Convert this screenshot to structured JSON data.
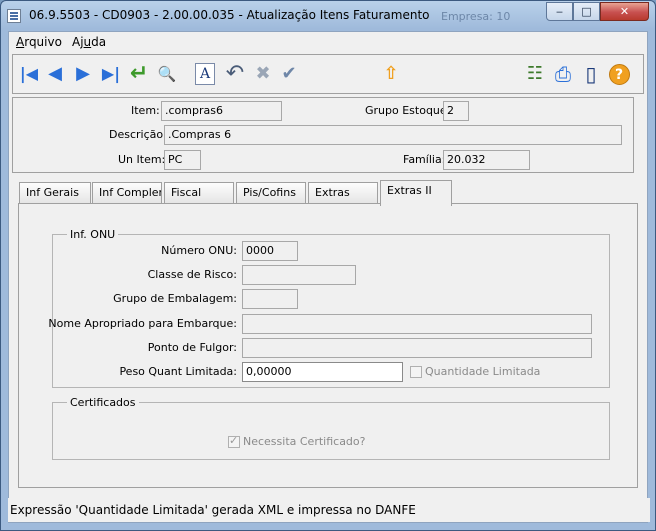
{
  "window": {
    "title": "06.9.5503 - CD0903 - 2.00.00.035 - Atualização Itens Faturamento",
    "background_label": "Empresa: 10",
    "minimize_symbol": "‒",
    "maximize_symbol": "□",
    "close_symbol": "✕"
  },
  "menu": {
    "arquivo": {
      "prefix": "",
      "accel": "A",
      "rest": "rquivo"
    },
    "ajuda": {
      "prefix": "Aj",
      "accel": "u",
      "rest": "da"
    }
  },
  "toolbar": {
    "buttons": [
      {
        "name": "first-record-icon",
        "glyph": "|◀"
      },
      {
        "name": "previous-record-icon",
        "glyph": "◀"
      },
      {
        "name": "next-record-icon",
        "glyph": "▶"
      },
      {
        "name": "last-record-icon",
        "glyph": "▶|"
      },
      {
        "name": "goto-icon",
        "glyph": "↵"
      },
      {
        "name": "search-icon",
        "glyph": "🔍"
      },
      {
        "name": "edit-document-icon",
        "glyph": "A"
      },
      {
        "name": "undo-icon",
        "glyph": "↶"
      },
      {
        "name": "delete-icon",
        "glyph": "✖"
      },
      {
        "name": "confirm-icon",
        "glyph": "✔"
      },
      {
        "name": "upload-icon",
        "glyph": "⇧"
      },
      {
        "name": "tree-icon",
        "glyph": "☷"
      },
      {
        "name": "print-icon",
        "glyph": "⎙"
      },
      {
        "name": "exit-icon",
        "glyph": "▯"
      },
      {
        "name": "help-icon",
        "glyph": "?"
      }
    ]
  },
  "header": {
    "item_label": "Item:",
    "item_value": ".compras6",
    "grupo_label": "Grupo Estoque:",
    "grupo_value": "2",
    "descricao_label": "Descrição:",
    "descricao_value": ".Compras 6",
    "unitem_label": "Un Item:",
    "unitem_value": "PC",
    "familia_label": "Família:",
    "familia_value": "20.032"
  },
  "tabs": [
    {
      "label": "Inf Gerais"
    },
    {
      "label": "Inf Complementares"
    },
    {
      "label": "Fiscal"
    },
    {
      "label": "Pis/Cofins"
    },
    {
      "label": "Extras"
    },
    {
      "label": "Extras II"
    }
  ],
  "onu": {
    "group_title": "Inf. ONU",
    "numero_label": "Número ONU:",
    "numero_value": "0000",
    "classe_label": "Classe de Risco:",
    "classe_value": "",
    "grupo_emb_label": "Grupo de Embalagem:",
    "grupo_emb_value": "",
    "nome_label": "Nome Apropriado para Embarque:",
    "nome_value": "",
    "ponto_label": "Ponto de Fulgor:",
    "ponto_value": "",
    "peso_label": "Peso Quant Limitada:",
    "peso_value": "0,00000",
    "quant_lim_label": "Quantidade Limitada",
    "quant_lim_checked": false
  },
  "certificados": {
    "group_title": "Certificados",
    "necessita_label": "Necessita Certificado?",
    "necessita_checked": true
  },
  "status_bar": {
    "text": "Expressão 'Quantidade Limitada' gerada XML e impressa no DANFE"
  },
  "colors": {
    "accent": "#2f6fd6",
    "toolbar_arrows": "#2a6fd8",
    "goto_green": "#3d9a2b",
    "help_orange": "#f0a020"
  }
}
